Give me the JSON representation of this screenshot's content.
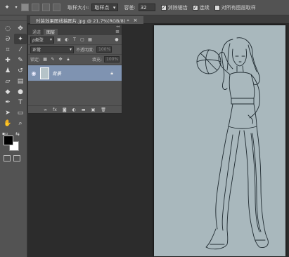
{
  "options_bar": {
    "sample_size_label": "取样大小:",
    "sample_size_value": "取样点",
    "tolerance_label": "容差:",
    "tolerance_value": "32",
    "antialias_label": "消除锯齿",
    "contiguous_label": "连续",
    "sample_all_layers_label": "对所有图层取样"
  },
  "document": {
    "tab_title": "时装效果图线稿图片.jpg @ 21.7%(RGB/8) *",
    "close_glyph": "×"
  },
  "layers_panel": {
    "tabs": [
      {
        "label": "通道"
      },
      {
        "label": "图层"
      }
    ],
    "kind_filter": "ρ类型",
    "blend_mode": "正常",
    "opacity_label": "不透明度:",
    "opacity_value": "100%",
    "lock_label": "锁定:",
    "fill_label": "填充:",
    "fill_value": "100%",
    "layer": {
      "name": "背景"
    }
  },
  "colors": {
    "foreground": "#000000",
    "background": "#ffffff",
    "paper": "#a9b8bd",
    "layer_selected": "#7f93b1"
  }
}
